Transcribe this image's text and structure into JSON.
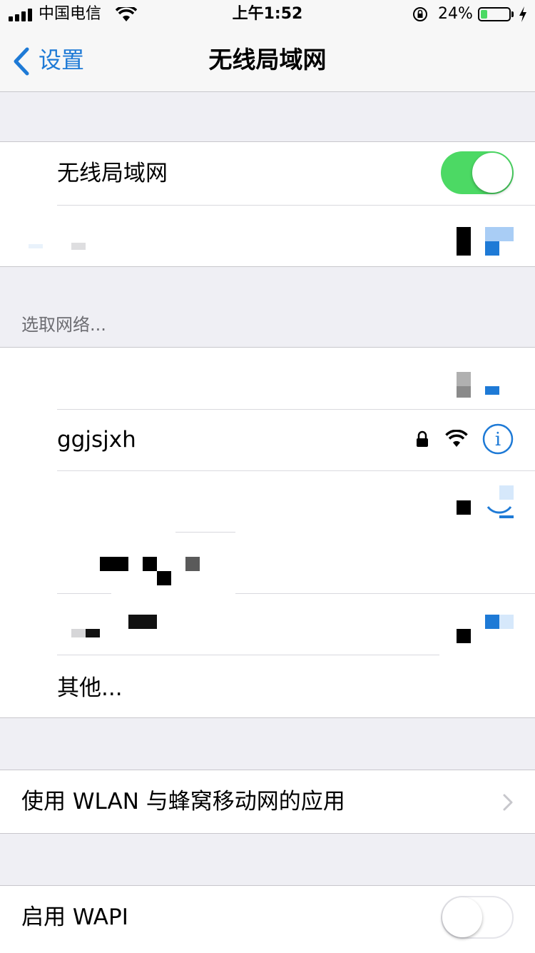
{
  "status_bar": {
    "carrier": "中国电信",
    "time": "上午1:52",
    "battery_percent": "24%",
    "battery_level": 0.24
  },
  "nav": {
    "back_label": "设置",
    "title": "无线局域网"
  },
  "wifi_toggle": {
    "label": "无线局域网",
    "on": true
  },
  "networks": {
    "header": "选取网络...",
    "visible_network": "ggjsjxh",
    "other_label": "其他..."
  },
  "apps_row": {
    "label": "使用 WLAN 与蜂窝移动网的应用"
  },
  "wapi_row": {
    "label": "启用 WAPI",
    "on": false
  },
  "colors": {
    "accent": "#1e7ad6",
    "toggle_on": "#4cd964",
    "background": "#efeff4"
  }
}
